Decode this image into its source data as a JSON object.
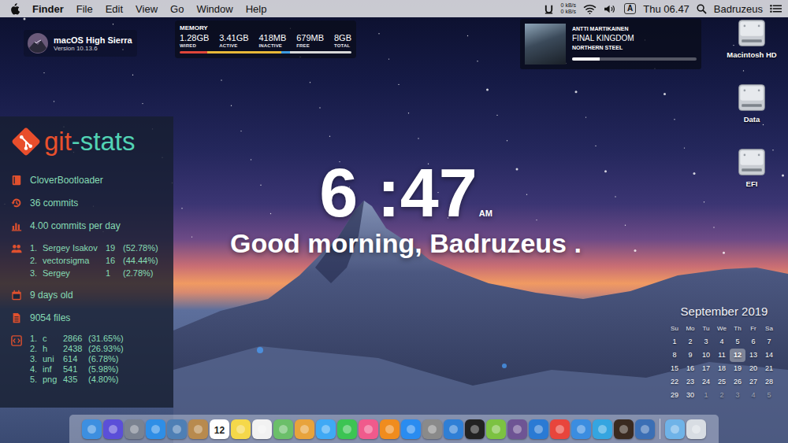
{
  "menu_bar": {
    "app_name": "Finder",
    "items": [
      "File",
      "Edit",
      "View",
      "Go",
      "Window",
      "Help"
    ],
    "network": {
      "upload": "0 kB/s",
      "download": "0 kB/s"
    },
    "input_source": "A",
    "clock": "Thu 06.47",
    "user": "Badruzeus"
  },
  "system_widget": {
    "title": "macOS High Sierra",
    "version": "Version 10.13.6"
  },
  "memory_widget": {
    "title": "MEMORY",
    "stats": [
      {
        "value": "1.28GB",
        "label": "WIRED"
      },
      {
        "value": "3.41GB",
        "label": "ACTIVE"
      },
      {
        "value": "418MB",
        "label": "INACTIVE"
      },
      {
        "value": "679MB",
        "label": "FREE"
      },
      {
        "value": "8GB",
        "label": "TOTAL"
      }
    ],
    "bar": [
      {
        "level": 0.16,
        "color": "#e0463a"
      },
      {
        "level": 0.43,
        "color": "#e8b838"
      },
      {
        "level": 0.05,
        "color": "#3d9be0"
      },
      {
        "level": 0.36,
        "color": "#d8d8d8"
      }
    ]
  },
  "now_playing": {
    "artist": "ANTTI MARTIKAINEN",
    "track": "FINAL KINGDOM",
    "album": "NORTHERN STEEL",
    "level": 0.22
  },
  "desktop_icons": [
    {
      "label": "Macintosh HD"
    },
    {
      "label": "Data"
    },
    {
      "label": "EFI"
    }
  ],
  "git_stats": {
    "logo": {
      "prefix": "git",
      "suffix": "-stats"
    },
    "repository": "CloverBootloader",
    "commits": "36 commits",
    "rate": "4.00 commits per day",
    "contributors": [
      {
        "rank": "1.",
        "name": "Sergey Isakov",
        "count": "19",
        "share": "(52.78%)"
      },
      {
        "rank": "2.",
        "name": "vectorsigma",
        "count": "16",
        "share": "(44.44%)"
      },
      {
        "rank": "3.",
        "name": "Sergey",
        "count": "1",
        "share": "(2.78%)"
      }
    ],
    "age": "9 days old",
    "files": "9054 files",
    "languages": [
      {
        "rank": "1.",
        "name": "c",
        "count": "2866",
        "share": "(31.65%)"
      },
      {
        "rank": "2.",
        "name": "h",
        "count": "2438",
        "share": "(26.93%)"
      },
      {
        "rank": "3.",
        "name": "uni",
        "count": "614",
        "share": "(6.78%)"
      },
      {
        "rank": "4.",
        "name": "inf",
        "count": "541",
        "share": "(5.98%)"
      },
      {
        "rank": "5.",
        "name": "png",
        "count": "435",
        "share": "(4.80%)"
      }
    ]
  },
  "clock": {
    "time": "6 :47",
    "period": "AM",
    "greeting": "Good morning, Badruzeus ."
  },
  "calendar": {
    "title": "September 2019",
    "weekdays": [
      "Su",
      "Mo",
      "Tu",
      "We",
      "Th",
      "Fr",
      "Sa"
    ],
    "days": [
      {
        "day": "1",
        "outside": false,
        "selected": false
      },
      {
        "day": "2",
        "outside": false,
        "selected": false
      },
      {
        "day": "3",
        "outside": false,
        "selected": false
      },
      {
        "day": "4",
        "outside": false,
        "selected": false
      },
      {
        "day": "5",
        "outside": false,
        "selected": false
      },
      {
        "day": "6",
        "outside": false,
        "selected": false
      },
      {
        "day": "7",
        "outside": false,
        "selected": false
      },
      {
        "day": "8",
        "outside": false,
        "selected": false
      },
      {
        "day": "9",
        "outside": false,
        "selected": false
      },
      {
        "day": "10",
        "outside": false,
        "selected": false
      },
      {
        "day": "11",
        "outside": false,
        "selected": false
      },
      {
        "day": "12",
        "outside": false,
        "selected": true
      },
      {
        "day": "13",
        "outside": false,
        "selected": false
      },
      {
        "day": "14",
        "outside": false,
        "selected": false
      },
      {
        "day": "15",
        "outside": false,
        "selected": false
      },
      {
        "day": "16",
        "outside": false,
        "selected": false
      },
      {
        "day": "17",
        "outside": false,
        "selected": false
      },
      {
        "day": "18",
        "outside": false,
        "selected": false
      },
      {
        "day": "19",
        "outside": false,
        "selected": false
      },
      {
        "day": "20",
        "outside": false,
        "selected": false
      },
      {
        "day": "21",
        "outside": false,
        "selected": false
      },
      {
        "day": "22",
        "outside": false,
        "selected": false
      },
      {
        "day": "23",
        "outside": false,
        "selected": false
      },
      {
        "day": "24",
        "outside": false,
        "selected": false
      },
      {
        "day": "25",
        "outside": false,
        "selected": false
      },
      {
        "day": "26",
        "outside": false,
        "selected": false
      },
      {
        "day": "27",
        "outside": false,
        "selected": false
      },
      {
        "day": "28",
        "outside": false,
        "selected": false
      },
      {
        "day": "29",
        "outside": false,
        "selected": false
      },
      {
        "day": "30",
        "outside": false,
        "selected": false
      },
      {
        "day": "1",
        "outside": true,
        "selected": false
      },
      {
        "day": "2",
        "outside": true,
        "selected": false
      },
      {
        "day": "3",
        "outside": true,
        "selected": false
      },
      {
        "day": "4",
        "outside": true,
        "selected": false
      },
      {
        "day": "5",
        "outside": true,
        "selected": false
      }
    ]
  },
  "dock": {
    "apps": [
      {
        "color": "#3d8fe0",
        "text": ""
      },
      {
        "color": "#5b4fd8",
        "text": ""
      },
      {
        "color": "#7a8290",
        "text": ""
      },
      {
        "color": "#2f8ee6",
        "text": ""
      },
      {
        "color": "#4e7fb5",
        "text": ""
      },
      {
        "color": "#b88a4e",
        "text": ""
      },
      {
        "color": "#ffffff",
        "text": "12"
      },
      {
        "color": "#f5d84a",
        "text": ""
      },
      {
        "color": "#f2f2f2",
        "text": ""
      },
      {
        "color": "#6bbf6a",
        "text": ""
      },
      {
        "color": "#e8a33c",
        "text": ""
      },
      {
        "color": "#3fa9f5",
        "text": ""
      },
      {
        "color": "#3cc453",
        "text": ""
      },
      {
        "color": "#f05a8c",
        "text": ""
      },
      {
        "color": "#f08c1e",
        "text": ""
      },
      {
        "color": "#2a8cf0",
        "text": ""
      },
      {
        "color": "#8a8a8a",
        "text": ""
      },
      {
        "color": "#2f7fd6",
        "text": ""
      },
      {
        "color": "#222222",
        "text": ""
      },
      {
        "color": "#7cc242",
        "text": ""
      },
      {
        "color": "#6e5494",
        "text": ""
      },
      {
        "color": "#2a7ad4",
        "text": ""
      },
      {
        "color": "#e8453c",
        "text": ""
      },
      {
        "color": "#3b8de0",
        "text": ""
      },
      {
        "color": "#35a5e0",
        "text": ""
      },
      {
        "color": "#3a2a20",
        "text": ""
      },
      {
        "color": "#3b6fb5",
        "text": ""
      }
    ],
    "stacks": [
      {
        "color": "#6fb3e8"
      },
      {
        "color": "#d8dde3"
      }
    ]
  }
}
